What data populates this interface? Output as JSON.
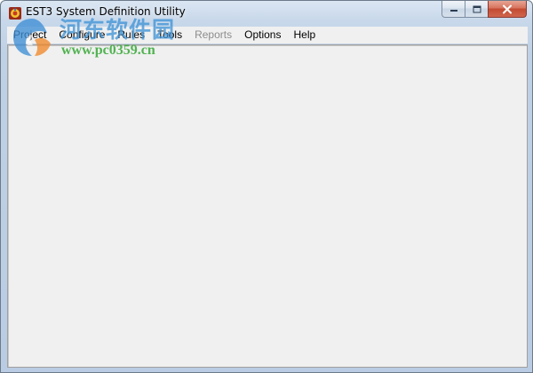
{
  "window": {
    "title": "EST3 System Definition Utility",
    "app_icon": "est3-app-icon"
  },
  "caption_buttons": {
    "minimize_icon": "minimize-icon",
    "maximize_icon": "maximize-icon",
    "close_icon": "close-icon"
  },
  "menubar": {
    "items": [
      {
        "label": "Project",
        "enabled": true
      },
      {
        "label": "Configure",
        "enabled": true
      },
      {
        "label": "Rules",
        "enabled": true
      },
      {
        "label": "Tools",
        "enabled": true
      },
      {
        "label": "Reports",
        "enabled": false
      },
      {
        "label": "Options",
        "enabled": true
      },
      {
        "label": "Help",
        "enabled": true
      }
    ]
  },
  "watermark": {
    "site_name": "河东软件园",
    "url": "www.pc0359.cn",
    "logo_icon": "swirl-logo-icon"
  },
  "colors": {
    "title_bar": "#c8d8ea",
    "client_bg": "#f0f0f0",
    "close_button": "#c24b32",
    "disabled_text": "#8d8d8d",
    "watermark_blue": "#4094d6",
    "watermark_green": "#3aaa3a"
  }
}
